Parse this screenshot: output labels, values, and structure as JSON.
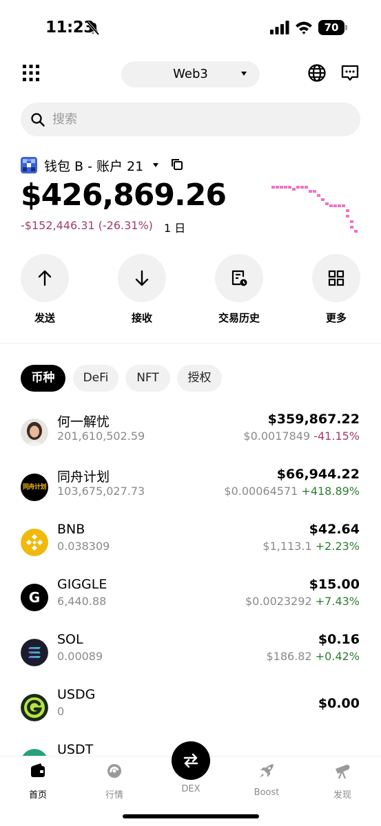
{
  "status_bar": {
    "time": "11:23",
    "battery": "70"
  },
  "header": {
    "network": "Web3"
  },
  "search": {
    "placeholder": "搜索"
  },
  "account": {
    "name": "钱包 B - 账户 21",
    "balance": "$426,869.26",
    "change": "-$152,446.31 (-26.31%)",
    "period": "1 日"
  },
  "actions": [
    {
      "label": "发送",
      "icon": "arrow-up-icon"
    },
    {
      "label": "接收",
      "icon": "arrow-down-icon"
    },
    {
      "label": "交易历史",
      "icon": "history-icon"
    },
    {
      "label": "更多",
      "icon": "grid-icon"
    }
  ],
  "tabs": [
    "币种",
    "DeFi",
    "NFT",
    "授权"
  ],
  "assets": [
    {
      "name": "何一解忧",
      "qty": "201,610,502.59",
      "value": "$359,867.22",
      "price": "$0.0017849",
      "change": "-41.15%",
      "trend": "down"
    },
    {
      "name": "同舟计划",
      "qty": "103,675,027.73",
      "value": "$66,944.22",
      "price": "$0.00064571",
      "change": "+418.89%",
      "trend": "up",
      "logo_text": "同舟计划"
    },
    {
      "name": "BNB",
      "qty": "0.038309",
      "value": "$42.64",
      "price": "$1,113.1",
      "change": "+2.23%",
      "trend": "up"
    },
    {
      "name": "GIGGLE",
      "qty": "6,440.88",
      "value": "$15.00",
      "price": "$0.0023292",
      "change": "+7.43%",
      "trend": "up",
      "logo_text": "G"
    },
    {
      "name": "SOL",
      "qty": "0.00089",
      "value": "$0.16",
      "price": "$186.82",
      "change": "+0.42%",
      "trend": "up"
    },
    {
      "name": "USDG",
      "qty": "0",
      "value": "$0.00",
      "price": "",
      "change": ""
    },
    {
      "name": "USDT",
      "qty": "",
      "value": "",
      "price": "",
      "change": ""
    }
  ],
  "bottom_nav": {
    "home": "首页",
    "market": "行情",
    "dex": "DEX",
    "boost": "Boost",
    "discover": "发现"
  },
  "colors": {
    "accent_down": "#a23b6a",
    "accent_up": "#2e7d32",
    "sparkline": "#f36fc6"
  }
}
